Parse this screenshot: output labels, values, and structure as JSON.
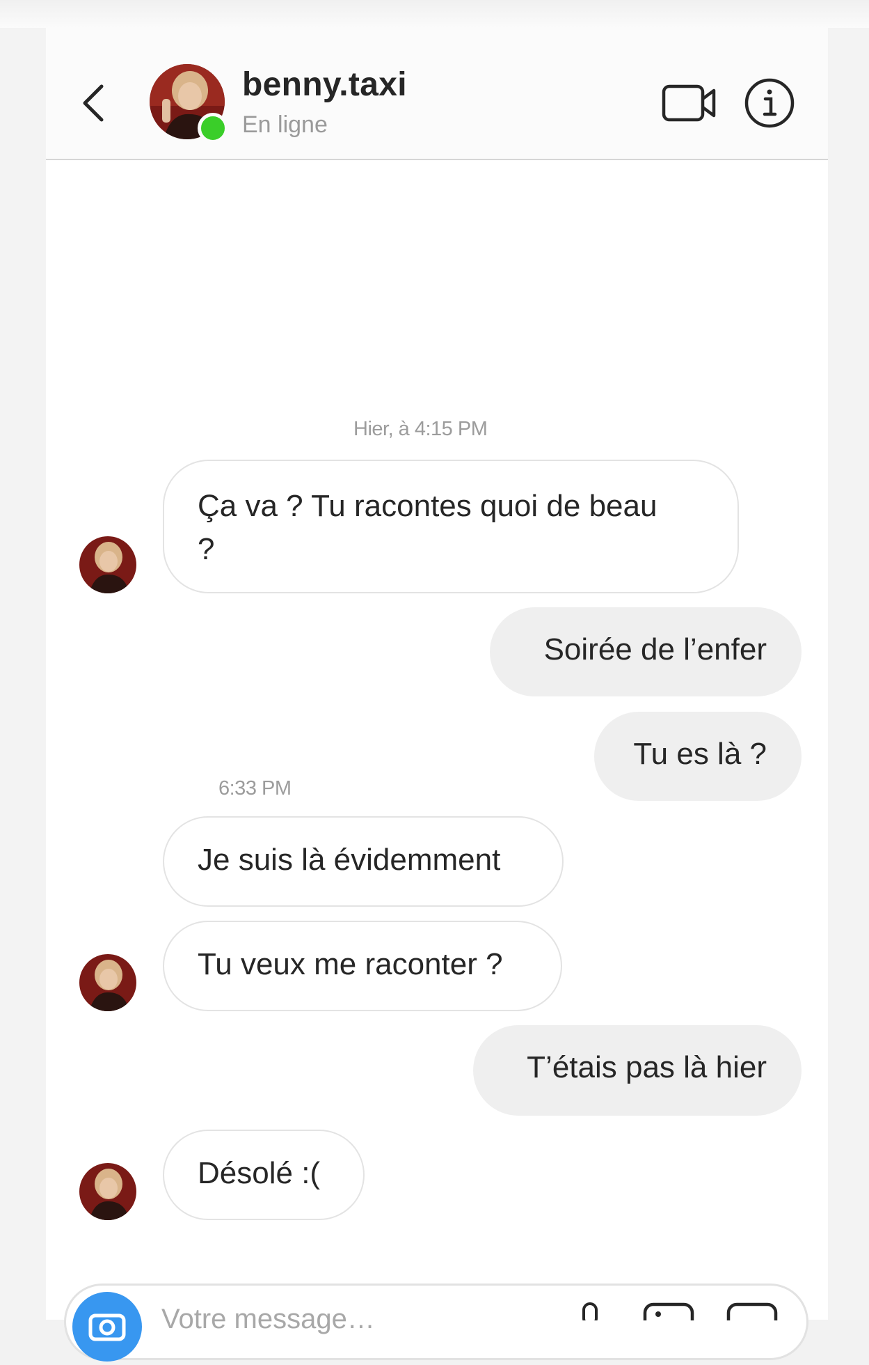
{
  "header": {
    "username": "benny.taxi",
    "status": "En ligne"
  },
  "messages": [
    {
      "type": "timestamp",
      "text": "Hier, à 4:15 PM"
    },
    {
      "type": "incoming",
      "line1": "Ça va ? Tu racontes quoi de beau",
      "line2": "?"
    },
    {
      "type": "outgoing",
      "text": "Soirée de l’enfer"
    },
    {
      "type": "outgoing",
      "text": "Tu es là ?"
    },
    {
      "type": "timestamp",
      "text": "6:33 PM"
    },
    {
      "type": "incoming",
      "text": "Je suis là évidemment"
    },
    {
      "type": "incoming",
      "text": "Tu veux me raconter ?"
    },
    {
      "type": "outgoing",
      "text": "T’étais pas là hier"
    },
    {
      "type": "incoming",
      "text": "Désolé :("
    }
  ],
  "composer": {
    "placeholder": "Votre message…"
  },
  "colors": {
    "online": "#3ace29",
    "outgoing_bubble": "#efefef",
    "camera_button": "#3897f0"
  },
  "icons": [
    "chevron-left-icon",
    "video-camera-icon",
    "info-icon",
    "camera-icon",
    "microphone-icon",
    "image-icon",
    "sticker-icon"
  ]
}
